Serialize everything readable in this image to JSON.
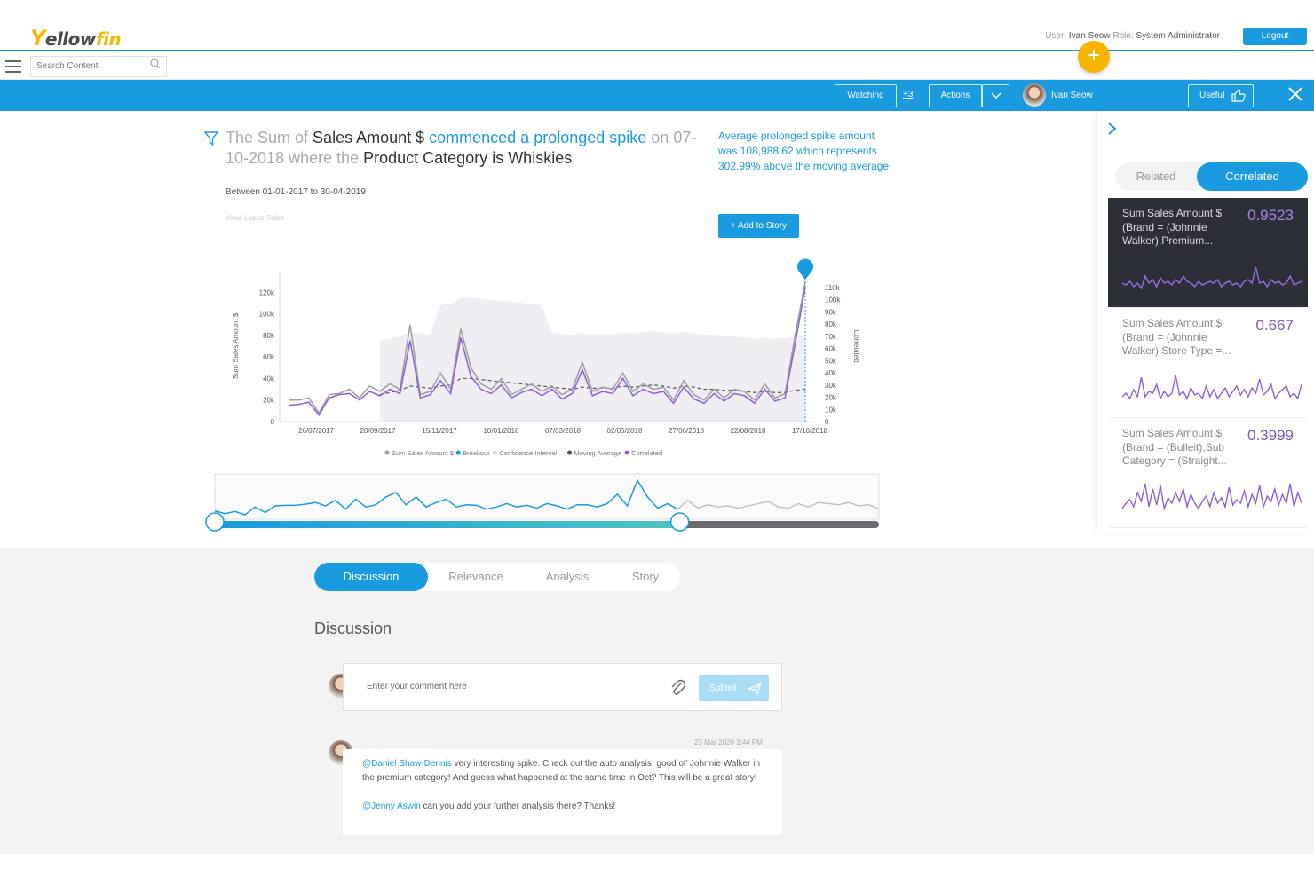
{
  "header": {
    "logo": {
      "y": "Y",
      "ellow": "ellow",
      "fin": "fin"
    },
    "user_prefix": "User:",
    "user_name": "Ivan Seow",
    "role_prefix": "Role:",
    "role": "System Administrator",
    "logout_label": "Logout",
    "fab_label": "+"
  },
  "search": {
    "placeholder": "Search Content"
  },
  "toolbar": {
    "watching_label": "Watching",
    "watchers_count": "+3",
    "actions_label": "Actions",
    "owner_name": "Ivan Seow",
    "useful_label": "Useful"
  },
  "insight": {
    "title_parts": [
      "The Sum of ",
      "Sales Amount $",
      " commenced a prolonged spike",
      " on ",
      "07-10-2018",
      " where the ",
      "Product Category is Whiskies"
    ],
    "date_range": "Between 01-01-2017 to 30-04-2019",
    "view": "View: Liquor Sales",
    "summary": "Average prolonged spike amount was 108,988.62 which represents 302.99% above the moving average",
    "add_to_story": "+ Add to Story"
  },
  "chart_data": {
    "type": "line",
    "title": "",
    "ylabel": "Sum Sales Amount $",
    "y2label": "Correlated",
    "ylim": [
      0,
      140000
    ],
    "y_ticks": [
      "0",
      "20k",
      "40k",
      "60k",
      "80k",
      "100k",
      "120k"
    ],
    "y2lim": [
      0,
      120000
    ],
    "y2_ticks": [
      "0",
      "10k",
      "20k",
      "30k",
      "40k",
      "50k",
      "60k",
      "70k",
      "80k",
      "90k",
      "100k",
      "110k"
    ],
    "x_ticks": [
      "26/07/2017",
      "20/09/2017",
      "15/11/2017",
      "10/01/2018",
      "07/03/2018",
      "02/05/2018",
      "27/06/2018",
      "22/08/2018",
      "17/10/2018"
    ],
    "legend": [
      "Sum Sales Amount $",
      "Breakout",
      "Confidence Interval",
      "Moving Average",
      "Correlated"
    ],
    "colors": {
      "sales": "#9e9e9e",
      "breakout": "#1a9be0",
      "confidence": "#eeeef3",
      "moving_average": "#555555",
      "correlated": "#8e5fd6"
    },
    "series": [
      {
        "name": "Sum Sales Amount $",
        "values": [
          20000,
          20000,
          22000,
          8000,
          25000,
          26000,
          30000,
          22000,
          33000,
          28000,
          35000,
          30000,
          90000,
          25000,
          28000,
          45000,
          30000,
          86000,
          50000,
          35000,
          30000,
          40000,
          25000,
          30000,
          35000,
          28000,
          33000,
          25000,
          30000,
          55000,
          28000,
          32000,
          30000,
          45000,
          28000,
          35000,
          30000,
          32000,
          20000,
          38000,
          25000,
          20000,
          30000,
          22000,
          30000,
          28000,
          20000,
          35000,
          22000,
          26000,
          80000,
          130000
        ]
      },
      {
        "name": "Correlated",
        "values": [
          15000,
          16000,
          18000,
          6000,
          22000,
          25000,
          26000,
          20000,
          28000,
          24000,
          30000,
          26000,
          75000,
          22000,
          25000,
          38000,
          26000,
          78000,
          42000,
          30000,
          26000,
          34000,
          22000,
          27000,
          30000,
          24000,
          30000,
          21000,
          26000,
          48000,
          24000,
          28000,
          26000,
          40000,
          24000,
          30000,
          26000,
          28000,
          17000,
          32000,
          21000,
          17000,
          26000,
          19000,
          26000,
          24000,
          17000,
          30000,
          19000,
          22000,
          72000,
          125000
        ]
      },
      {
        "name": "Moving Average",
        "values": [
          null,
          null,
          null,
          null,
          null,
          null,
          null,
          null,
          null,
          25000,
          27000,
          29000,
          33000,
          32000,
          31000,
          33000,
          34000,
          40000,
          40000,
          39000,
          38000,
          37000,
          36000,
          35000,
          34000,
          33000,
          32000,
          31000,
          30000,
          32000,
          31000,
          31000,
          31000,
          33000,
          32000,
          33000,
          34000,
          33000,
          31000,
          33000,
          32000,
          30000,
          30000,
          29000,
          29000,
          28000,
          27000,
          28000,
          27000,
          27000,
          29000,
          30000
        ]
      }
    ],
    "overview": {
      "values": [
        15,
        10,
        14,
        8,
        22,
        12,
        24,
        25,
        25,
        27,
        30,
        24,
        34,
        18,
        36,
        22,
        26,
        40,
        48,
        26,
        40,
        22,
        30,
        36,
        22,
        26,
        25,
        18,
        22,
        28,
        22,
        25,
        20,
        28,
        24,
        18,
        26,
        26,
        22,
        28,
        45,
        24,
        70,
        40,
        20,
        28,
        18,
        34,
        20,
        26,
        22,
        24,
        20,
        24,
        28,
        32,
        22,
        20,
        28,
        22,
        30,
        28,
        26,
        30,
        24,
        26,
        18
      ],
      "selected_fraction": 0.7
    }
  },
  "right_panel": {
    "tabs": [
      "Related",
      "Correlated"
    ],
    "active_tab": "Correlated",
    "cards": [
      {
        "title": "Sum Sales Amount $ (Brand = (Johnnie Walker),Premium...",
        "value": "0.9523",
        "spark": [
          30,
          32,
          28,
          34,
          30,
          36,
          22,
          30,
          26,
          34,
          24,
          30,
          28,
          32,
          26,
          30,
          22,
          28,
          30,
          34,
          28,
          32,
          30,
          28,
          30,
          26,
          34,
          30,
          28,
          32,
          30,
          34,
          28,
          26,
          30,
          12,
          30,
          28,
          34,
          26,
          30,
          28,
          32,
          30,
          22,
          32,
          30,
          28
        ]
      },
      {
        "title": "Sum Sales Amount $ (Brand = (Johnnie Walker),Store Type =...",
        "value": "0.667",
        "spark": [
          34,
          30,
          36,
          26,
          34,
          12,
          34,
          28,
          30,
          20,
          36,
          28,
          34,
          30,
          10,
          32,
          28,
          36,
          24,
          32,
          30,
          36,
          22,
          34,
          26,
          36,
          30,
          24,
          34,
          28,
          22,
          32,
          26,
          34,
          24,
          30,
          14,
          32,
          28,
          20,
          36,
          30,
          26,
          22,
          34,
          30,
          36,
          20
        ]
      },
      {
        "title": "Sum Sales Amount $ (Brand = (Bulleit),Sub Category = (Straight...",
        "value": "0.3999",
        "spark": [
          36,
          30,
          26,
          34,
          18,
          28,
          8,
          34,
          14,
          32,
          10,
          36,
          24,
          30,
          18,
          28,
          14,
          34,
          20,
          30,
          36,
          28,
          22,
          34,
          18,
          30,
          24,
          34,
          12,
          32,
          26,
          30,
          16,
          34,
          20,
          30,
          10,
          34,
          22,
          28,
          14,
          32,
          20,
          30,
          8,
          34,
          18,
          30
        ]
      }
    ]
  },
  "lower": {
    "tabs": [
      "Discussion",
      "Relevance",
      "Analysis",
      "Story"
    ],
    "active_tab": "Discussion",
    "heading": "Discussion",
    "comment_placeholder": "Enter your comment here",
    "submit_label": "Submit",
    "message": {
      "timestamp": "23 Mar 2020 3:44 PM",
      "mention1": "@Daniel Shaw-Dennis",
      "text1": " very interesting spike. Check out the auto analysis, good ol' Johnnie Walker in the premium category! And guess what happened at the same time in Oct? This will be a great story!",
      "mention2": "@Jenny Aswin",
      "text2": " can you add your further analysis there? Thanks!"
    }
  }
}
